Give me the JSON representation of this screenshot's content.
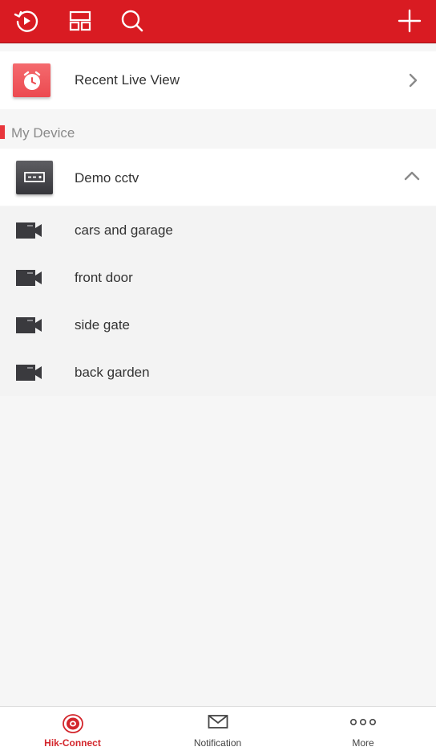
{
  "header": {
    "icons": [
      "playback-icon",
      "layout-icon",
      "search-icon",
      "add-icon"
    ],
    "background": "#d91b22"
  },
  "recent": {
    "label": "Recent Live View",
    "icon": "clock-icon"
  },
  "section": {
    "label": "My Device"
  },
  "device": {
    "name": "Demo cctv",
    "icon": "dvr-icon",
    "expanded": true
  },
  "channels": [
    {
      "label": "cars and garage",
      "icon": "camera-icon"
    },
    {
      "label": "front door",
      "icon": "camera-icon"
    },
    {
      "label": "side gate",
      "icon": "camera-icon"
    },
    {
      "label": "back garden",
      "icon": "camera-icon"
    }
  ],
  "tabs": [
    {
      "label": "Hik-Connect",
      "icon": "hik-connect-icon",
      "active": true
    },
    {
      "label": "Notification",
      "icon": "envelope-icon",
      "active": false
    },
    {
      "label": "More",
      "icon": "more-dots-icon",
      "active": false
    }
  ],
  "colors": {
    "accent": "#d91b22",
    "active_tab": "#d3262c",
    "inactive_tab": "#444444"
  }
}
